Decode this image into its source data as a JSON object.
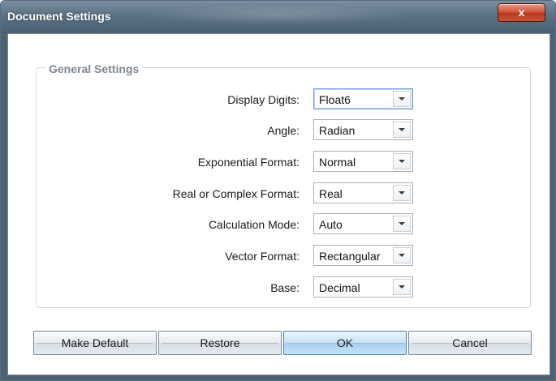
{
  "window": {
    "title": "Document Settings",
    "close_glyph": "x"
  },
  "group": {
    "label": "General Settings"
  },
  "settings": [
    {
      "label": "Display Digits:",
      "value": "Float6"
    },
    {
      "label": "Angle:",
      "value": "Radian"
    },
    {
      "label": "Exponential Format:",
      "value": "Normal"
    },
    {
      "label": "Real or Complex Format:",
      "value": "Real"
    },
    {
      "label": "Calculation Mode:",
      "value": "Auto"
    },
    {
      "label": "Vector Format:",
      "value": "Rectangular"
    },
    {
      "label": "Base:",
      "value": "Decimal"
    }
  ],
  "buttons": {
    "make_default": "Make Default",
    "restore": "Restore",
    "ok": "OK",
    "cancel": "Cancel"
  },
  "colors": {
    "titlebar": "#5b7184",
    "close_button": "#c7543b",
    "primary_button": "#a9d0f1"
  }
}
